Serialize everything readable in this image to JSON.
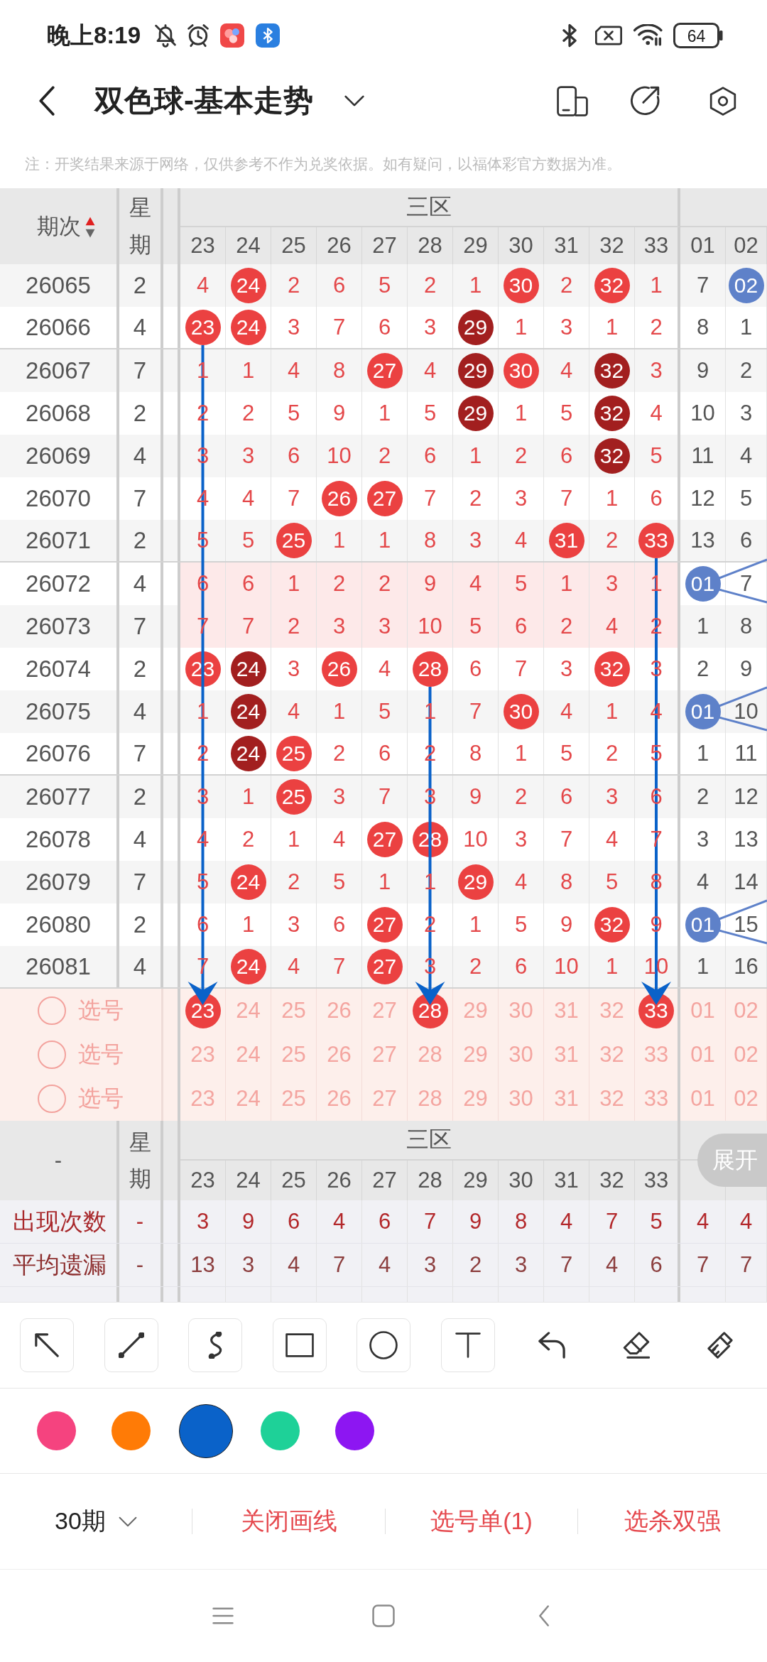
{
  "status_bar": {
    "time": "晚上8:19",
    "battery": "64"
  },
  "header": {
    "title": "双色球-基本走势"
  },
  "note": "注：开奖结果来源于网络，仅供参考不作为兑奖依据。如有疑问，以福体彩官方数据为准。",
  "table": {
    "issue_header": "期次",
    "sort_ascending": true,
    "weekday_header": "星期",
    "zone_title": "三区",
    "columns": [
      {
        "label": "23",
        "kind": "red"
      },
      {
        "label": "24",
        "kind": "red"
      },
      {
        "label": "25",
        "kind": "red"
      },
      {
        "label": "26",
        "kind": "red"
      },
      {
        "label": "27",
        "kind": "red"
      },
      {
        "label": "28",
        "kind": "red"
      },
      {
        "label": "29",
        "kind": "red"
      },
      {
        "label": "30",
        "kind": "red"
      },
      {
        "label": "31",
        "kind": "red"
      },
      {
        "label": "32",
        "kind": "red"
      },
      {
        "label": "33",
        "kind": "red"
      },
      {
        "label": "01",
        "kind": "blue"
      },
      {
        "label": "02",
        "kind": "blue"
      }
    ],
    "rows": [
      {
        "issue": "26065",
        "weekday": "2",
        "highlighted": false,
        "cells": [
          {
            "text": "4",
            "kind": "miss"
          },
          {
            "text": "24",
            "kind": "hit"
          },
          {
            "text": "2",
            "kind": "miss"
          },
          {
            "text": "6",
            "kind": "miss"
          },
          {
            "text": "5",
            "kind": "miss"
          },
          {
            "text": "2",
            "kind": "miss"
          },
          {
            "text": "1",
            "kind": "miss"
          },
          {
            "text": "30",
            "kind": "hit"
          },
          {
            "text": "2",
            "kind": "miss"
          },
          {
            "text": "32",
            "kind": "hit"
          },
          {
            "text": "1",
            "kind": "miss"
          },
          {
            "text": "7",
            "kind": "miss"
          },
          {
            "text": "02",
            "kind": "hit"
          }
        ]
      },
      {
        "issue": "26066",
        "weekday": "4",
        "highlighted": false,
        "cells": [
          {
            "text": "23",
            "kind": "arrow_origin"
          },
          {
            "text": "24",
            "kind": "hit"
          },
          {
            "text": "3",
            "kind": "miss"
          },
          {
            "text": "7",
            "kind": "miss"
          },
          {
            "text": "6",
            "kind": "miss"
          },
          {
            "text": "3",
            "kind": "miss"
          },
          {
            "text": "29",
            "kind": "streak"
          },
          {
            "text": "1",
            "kind": "miss"
          },
          {
            "text": "3",
            "kind": "miss"
          },
          {
            "text": "1",
            "kind": "miss"
          },
          {
            "text": "2",
            "kind": "miss"
          },
          {
            "text": "8",
            "kind": "miss"
          },
          {
            "text": "1",
            "kind": "miss"
          }
        ]
      },
      {
        "issue": "26067",
        "weekday": "7",
        "highlighted": false,
        "cells": [
          {
            "text": "1",
            "kind": "miss"
          },
          {
            "text": "1",
            "kind": "miss"
          },
          {
            "text": "4",
            "kind": "miss"
          },
          {
            "text": "8",
            "kind": "miss"
          },
          {
            "text": "27",
            "kind": "hit"
          },
          {
            "text": "4",
            "kind": "miss"
          },
          {
            "text": "29",
            "kind": "streak"
          },
          {
            "text": "30",
            "kind": "hit"
          },
          {
            "text": "4",
            "kind": "miss"
          },
          {
            "text": "32",
            "kind": "streak"
          },
          {
            "text": "3",
            "kind": "miss"
          },
          {
            "text": "9",
            "kind": "miss"
          },
          {
            "text": "2",
            "kind": "miss"
          }
        ]
      },
      {
        "issue": "26068",
        "weekday": "2",
        "highlighted": false,
        "cells": [
          {
            "text": "2",
            "kind": "miss"
          },
          {
            "text": "2",
            "kind": "miss"
          },
          {
            "text": "5",
            "kind": "miss"
          },
          {
            "text": "9",
            "kind": "miss"
          },
          {
            "text": "1",
            "kind": "miss"
          },
          {
            "text": "5",
            "kind": "miss"
          },
          {
            "text": "29",
            "kind": "streak"
          },
          {
            "text": "1",
            "kind": "miss"
          },
          {
            "text": "5",
            "kind": "miss"
          },
          {
            "text": "32",
            "kind": "streak"
          },
          {
            "text": "4",
            "kind": "miss"
          },
          {
            "text": "10",
            "kind": "miss"
          },
          {
            "text": "3",
            "kind": "miss"
          }
        ]
      },
      {
        "issue": "26069",
        "weekday": "4",
        "highlighted": false,
        "cells": [
          {
            "text": "3",
            "kind": "miss"
          },
          {
            "text": "3",
            "kind": "miss"
          },
          {
            "text": "6",
            "kind": "miss"
          },
          {
            "text": "10",
            "kind": "miss"
          },
          {
            "text": "2",
            "kind": "miss"
          },
          {
            "text": "6",
            "kind": "miss"
          },
          {
            "text": "1",
            "kind": "miss"
          },
          {
            "text": "2",
            "kind": "miss"
          },
          {
            "text": "6",
            "kind": "miss"
          },
          {
            "text": "32",
            "kind": "streak"
          },
          {
            "text": "5",
            "kind": "miss"
          },
          {
            "text": "11",
            "kind": "miss"
          },
          {
            "text": "4",
            "kind": "miss"
          }
        ]
      },
      {
        "issue": "26070",
        "weekday": "7",
        "highlighted": false,
        "cells": [
          {
            "text": "4",
            "kind": "miss"
          },
          {
            "text": "4",
            "kind": "miss"
          },
          {
            "text": "7",
            "kind": "miss"
          },
          {
            "text": "26",
            "kind": "hit"
          },
          {
            "text": "27",
            "kind": "hit"
          },
          {
            "text": "7",
            "kind": "miss"
          },
          {
            "text": "2",
            "kind": "miss"
          },
          {
            "text": "3",
            "kind": "miss"
          },
          {
            "text": "7",
            "kind": "miss"
          },
          {
            "text": "1",
            "kind": "miss"
          },
          {
            "text": "6",
            "kind": "miss"
          },
          {
            "text": "12",
            "kind": "miss"
          },
          {
            "text": "5",
            "kind": "miss"
          }
        ]
      },
      {
        "issue": "26071",
        "weekday": "2",
        "highlighted": false,
        "cells": [
          {
            "text": "5",
            "kind": "miss"
          },
          {
            "text": "5",
            "kind": "miss"
          },
          {
            "text": "25",
            "kind": "hit"
          },
          {
            "text": "1",
            "kind": "miss"
          },
          {
            "text": "1",
            "kind": "miss"
          },
          {
            "text": "8",
            "kind": "miss"
          },
          {
            "text": "3",
            "kind": "miss"
          },
          {
            "text": "4",
            "kind": "miss"
          },
          {
            "text": "31",
            "kind": "hit"
          },
          {
            "text": "2",
            "kind": "miss"
          },
          {
            "text": "33",
            "kind": "arrow_origin"
          },
          {
            "text": "13",
            "kind": "miss"
          },
          {
            "text": "6",
            "kind": "miss"
          }
        ]
      },
      {
        "issue": "26072",
        "weekday": "4",
        "highlighted": true,
        "cells": [
          {
            "text": "6",
            "kind": "miss"
          },
          {
            "text": "6",
            "kind": "miss"
          },
          {
            "text": "1",
            "kind": "miss"
          },
          {
            "text": "2",
            "kind": "miss"
          },
          {
            "text": "2",
            "kind": "miss"
          },
          {
            "text": "9",
            "kind": "miss"
          },
          {
            "text": "4",
            "kind": "miss"
          },
          {
            "text": "5",
            "kind": "miss"
          },
          {
            "text": "1",
            "kind": "miss"
          },
          {
            "text": "3",
            "kind": "miss"
          },
          {
            "text": "1",
            "kind": "miss"
          },
          {
            "text": "01",
            "kind": "hit"
          },
          {
            "text": "7",
            "kind": "miss"
          }
        ]
      },
      {
        "issue": "26073",
        "weekday": "7",
        "highlighted": true,
        "cells": [
          {
            "text": "7",
            "kind": "miss"
          },
          {
            "text": "7",
            "kind": "miss"
          },
          {
            "text": "2",
            "kind": "miss"
          },
          {
            "text": "3",
            "kind": "miss"
          },
          {
            "text": "3",
            "kind": "miss"
          },
          {
            "text": "10",
            "kind": "miss"
          },
          {
            "text": "5",
            "kind": "miss"
          },
          {
            "text": "6",
            "kind": "miss"
          },
          {
            "text": "2",
            "kind": "miss"
          },
          {
            "text": "4",
            "kind": "miss"
          },
          {
            "text": "2",
            "kind": "miss"
          },
          {
            "text": "1",
            "kind": "miss"
          },
          {
            "text": "8",
            "kind": "miss"
          }
        ]
      },
      {
        "issue": "26074",
        "weekday": "2",
        "highlighted": false,
        "cells": [
          {
            "text": "23",
            "kind": "hit"
          },
          {
            "text": "24",
            "kind": "streak"
          },
          {
            "text": "3",
            "kind": "miss"
          },
          {
            "text": "26",
            "kind": "hit"
          },
          {
            "text": "4",
            "kind": "miss"
          },
          {
            "text": "28",
            "kind": "arrow_origin"
          },
          {
            "text": "6",
            "kind": "miss"
          },
          {
            "text": "7",
            "kind": "miss"
          },
          {
            "text": "3",
            "kind": "miss"
          },
          {
            "text": "32",
            "kind": "hit"
          },
          {
            "text": "3",
            "kind": "miss"
          },
          {
            "text": "2",
            "kind": "miss"
          },
          {
            "text": "9",
            "kind": "miss"
          }
        ]
      },
      {
        "issue": "26075",
        "weekday": "4",
        "highlighted": false,
        "cells": [
          {
            "text": "1",
            "kind": "miss"
          },
          {
            "text": "24",
            "kind": "streak"
          },
          {
            "text": "4",
            "kind": "miss"
          },
          {
            "text": "1",
            "kind": "miss"
          },
          {
            "text": "5",
            "kind": "miss"
          },
          {
            "text": "1",
            "kind": "miss"
          },
          {
            "text": "7",
            "kind": "miss"
          },
          {
            "text": "30",
            "kind": "hit"
          },
          {
            "text": "4",
            "kind": "miss"
          },
          {
            "text": "1",
            "kind": "miss"
          },
          {
            "text": "4",
            "kind": "miss"
          },
          {
            "text": "01",
            "kind": "hit"
          },
          {
            "text": "10",
            "kind": "miss"
          }
        ]
      },
      {
        "issue": "26076",
        "weekday": "7",
        "highlighted": false,
        "cells": [
          {
            "text": "2",
            "kind": "miss"
          },
          {
            "text": "24",
            "kind": "streak"
          },
          {
            "text": "25",
            "kind": "hit"
          },
          {
            "text": "2",
            "kind": "miss"
          },
          {
            "text": "6",
            "kind": "miss"
          },
          {
            "text": "2",
            "kind": "miss"
          },
          {
            "text": "8",
            "kind": "miss"
          },
          {
            "text": "1",
            "kind": "miss"
          },
          {
            "text": "5",
            "kind": "miss"
          },
          {
            "text": "2",
            "kind": "miss"
          },
          {
            "text": "5",
            "kind": "miss"
          },
          {
            "text": "1",
            "kind": "miss"
          },
          {
            "text": "11",
            "kind": "miss"
          }
        ]
      },
      {
        "issue": "26077",
        "weekday": "2",
        "highlighted": false,
        "cells": [
          {
            "text": "3",
            "kind": "miss"
          },
          {
            "text": "1",
            "kind": "miss"
          },
          {
            "text": "25",
            "kind": "hit"
          },
          {
            "text": "3",
            "kind": "miss"
          },
          {
            "text": "7",
            "kind": "miss"
          },
          {
            "text": "3",
            "kind": "miss"
          },
          {
            "text": "9",
            "kind": "miss"
          },
          {
            "text": "2",
            "kind": "miss"
          },
          {
            "text": "6",
            "kind": "miss"
          },
          {
            "text": "3",
            "kind": "miss"
          },
          {
            "text": "6",
            "kind": "miss"
          },
          {
            "text": "2",
            "kind": "miss"
          },
          {
            "text": "12",
            "kind": "miss"
          }
        ]
      },
      {
        "issue": "26078",
        "weekday": "4",
        "highlighted": false,
        "cells": [
          {
            "text": "4",
            "kind": "miss"
          },
          {
            "text": "2",
            "kind": "miss"
          },
          {
            "text": "1",
            "kind": "miss"
          },
          {
            "text": "4",
            "kind": "miss"
          },
          {
            "text": "27",
            "kind": "hit"
          },
          {
            "text": "28",
            "kind": "hit"
          },
          {
            "text": "10",
            "kind": "miss"
          },
          {
            "text": "3",
            "kind": "miss"
          },
          {
            "text": "7",
            "kind": "miss"
          },
          {
            "text": "4",
            "kind": "miss"
          },
          {
            "text": "7",
            "kind": "miss"
          },
          {
            "text": "3",
            "kind": "miss"
          },
          {
            "text": "13",
            "kind": "miss"
          }
        ]
      },
      {
        "issue": "26079",
        "weekday": "7",
        "highlighted": false,
        "cells": [
          {
            "text": "5",
            "kind": "miss"
          },
          {
            "text": "24",
            "kind": "hit"
          },
          {
            "text": "2",
            "kind": "miss"
          },
          {
            "text": "5",
            "kind": "miss"
          },
          {
            "text": "1",
            "kind": "miss"
          },
          {
            "text": "1",
            "kind": "miss"
          },
          {
            "text": "29",
            "kind": "hit"
          },
          {
            "text": "4",
            "kind": "miss"
          },
          {
            "text": "8",
            "kind": "miss"
          },
          {
            "text": "5",
            "kind": "miss"
          },
          {
            "text": "8",
            "kind": "miss"
          },
          {
            "text": "4",
            "kind": "miss"
          },
          {
            "text": "14",
            "kind": "miss"
          }
        ]
      },
      {
        "issue": "26080",
        "weekday": "2",
        "highlighted": false,
        "cells": [
          {
            "text": "6",
            "kind": "miss"
          },
          {
            "text": "1",
            "kind": "miss"
          },
          {
            "text": "3",
            "kind": "miss"
          },
          {
            "text": "6",
            "kind": "miss"
          },
          {
            "text": "27",
            "kind": "hit"
          },
          {
            "text": "2",
            "kind": "miss"
          },
          {
            "text": "1",
            "kind": "miss"
          },
          {
            "text": "5",
            "kind": "miss"
          },
          {
            "text": "9",
            "kind": "miss"
          },
          {
            "text": "32",
            "kind": "hit"
          },
          {
            "text": "9",
            "kind": "miss"
          },
          {
            "text": "01",
            "kind": "hit"
          },
          {
            "text": "15",
            "kind": "miss"
          }
        ]
      },
      {
        "issue": "26081",
        "weekday": "4",
        "highlighted": false,
        "cells": [
          {
            "text": "7",
            "kind": "miss"
          },
          {
            "text": "24",
            "kind": "hit"
          },
          {
            "text": "4",
            "kind": "miss"
          },
          {
            "text": "7",
            "kind": "miss"
          },
          {
            "text": "27",
            "kind": "hit"
          },
          {
            "text": "3",
            "kind": "miss"
          },
          {
            "text": "2",
            "kind": "miss"
          },
          {
            "text": "6",
            "kind": "miss"
          },
          {
            "text": "10",
            "kind": "miss"
          },
          {
            "text": "1",
            "kind": "miss"
          },
          {
            "text": "10",
            "kind": "miss"
          },
          {
            "text": "1",
            "kind": "miss"
          },
          {
            "text": "16",
            "kind": "miss"
          }
        ]
      }
    ],
    "pick_rows": [
      {
        "label": "选号",
        "checked": false,
        "numbers": [
          {
            "text": "23",
            "selected": true
          },
          {
            "text": "24",
            "selected": false
          },
          {
            "text": "25",
            "selected": false
          },
          {
            "text": "26",
            "selected": false
          },
          {
            "text": "27",
            "selected": false
          },
          {
            "text": "28",
            "selected": true
          },
          {
            "text": "29",
            "selected": false
          },
          {
            "text": "30",
            "selected": false
          },
          {
            "text": "31",
            "selected": false
          },
          {
            "text": "32",
            "selected": false
          },
          {
            "text": "33",
            "selected": true
          },
          {
            "text": "01",
            "selected": false
          },
          {
            "text": "02",
            "selected": false
          }
        ]
      },
      {
        "label": "选号",
        "checked": false,
        "numbers": [
          {
            "text": "23",
            "selected": false
          },
          {
            "text": "24",
            "selected": false
          },
          {
            "text": "25",
            "selected": false
          },
          {
            "text": "26",
            "selected": false
          },
          {
            "text": "27",
            "selected": false
          },
          {
            "text": "28",
            "selected": false
          },
          {
            "text": "29",
            "selected": false
          },
          {
            "text": "30",
            "selected": false
          },
          {
            "text": "31",
            "selected": false
          },
          {
            "text": "32",
            "selected": false
          },
          {
            "text": "33",
            "selected": false
          },
          {
            "text": "01",
            "selected": false
          },
          {
            "text": "02",
            "selected": false
          }
        ]
      },
      {
        "label": "选号",
        "checked": false,
        "numbers": [
          {
            "text": "23",
            "selected": false
          },
          {
            "text": "24",
            "selected": false
          },
          {
            "text": "25",
            "selected": false
          },
          {
            "text": "26",
            "selected": false
          },
          {
            "text": "27",
            "selected": false
          },
          {
            "text": "28",
            "selected": false
          },
          {
            "text": "29",
            "selected": false
          },
          {
            "text": "30",
            "selected": false
          },
          {
            "text": "31",
            "selected": false
          },
          {
            "text": "32",
            "selected": false
          },
          {
            "text": "33",
            "selected": false
          },
          {
            "text": "01",
            "selected": false
          },
          {
            "text": "02",
            "selected": false
          }
        ]
      }
    ]
  },
  "stats": {
    "first_header": "-",
    "weekday_header": "星期",
    "zone_title": "三区",
    "columns": [
      "23",
      "24",
      "25",
      "26",
      "27",
      "28",
      "29",
      "30",
      "31",
      "32",
      "33"
    ],
    "expand_button": "展开",
    "rows": [
      {
        "label": "出现次数",
        "kind": "count",
        "weekday": "-",
        "values": [
          "3",
          "9",
          "6",
          "4",
          "6",
          "7",
          "9",
          "8",
          "4",
          "7",
          "5",
          "4",
          "4"
        ]
      },
      {
        "label": "平均遗漏",
        "kind": "average",
        "weekday": "-",
        "values": [
          "13",
          "3",
          "4",
          "7",
          "4",
          "3",
          "2",
          "3",
          "7",
          "4",
          "6",
          "7",
          "7"
        ]
      }
    ]
  },
  "draw_tools": {
    "colors": [
      {
        "color": "#f5437f",
        "selected": false
      },
      {
        "color": "#ff7b06",
        "selected": false
      },
      {
        "color": "#0a62c9",
        "selected": true
      },
      {
        "color": "#1ed198",
        "selected": false
      },
      {
        "color": "#8d16f2",
        "selected": false
      }
    ]
  },
  "bottom_bar": {
    "period": "30期",
    "actions": [
      "关闭画线",
      "选号单(1)",
      "选杀双强"
    ]
  }
}
